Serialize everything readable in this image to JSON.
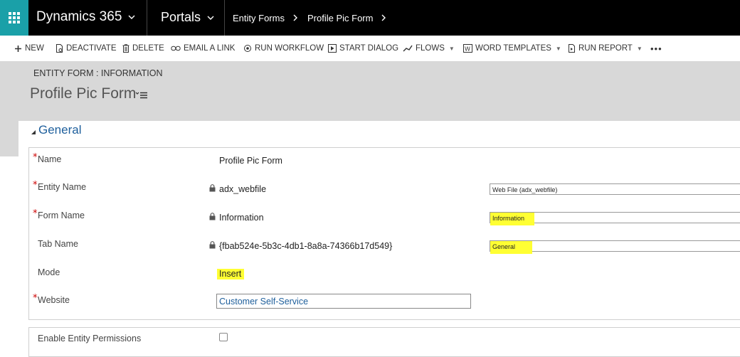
{
  "nav": {
    "app_name": "Dynamics 365",
    "area": "Portals",
    "breadcrumb": [
      "Entity Forms",
      "Profile Pic Form"
    ]
  },
  "commands": {
    "new": "NEW",
    "deactivate": "DEACTIVATE",
    "delete": "DELETE",
    "email_link": "EMAIL A LINK",
    "run_workflow": "RUN WORKFLOW",
    "start_dialog": "START DIALOG",
    "flows": "FLOWS",
    "word_templates": "WORD TEMPLATES",
    "run_report": "RUN REPORT",
    "more": "•••"
  },
  "header": {
    "entity_label": "ENTITY FORM : INFORMATION",
    "title": "Profile Pic Form"
  },
  "section": {
    "title": "General"
  },
  "fields": {
    "name": {
      "label": "Name",
      "value": "Profile Pic Form"
    },
    "entity_name": {
      "label": "Entity Name",
      "value": "adx_webfile",
      "select": "Web File (adx_webfile)"
    },
    "form_name": {
      "label": "Form Name",
      "value": "Information",
      "select": "Information"
    },
    "tab_name": {
      "label": "Tab Name",
      "value": "{fbab524e-5b3c-4db1-8a8a-74366b17d549}",
      "select": "General"
    },
    "mode": {
      "label": "Mode",
      "value": "Insert"
    },
    "website": {
      "label": "Website",
      "value": "Customer Self-Service"
    },
    "enable_permissions": {
      "label": "Enable Entity Permissions"
    }
  },
  "required_mark": "*",
  "colors": {
    "accent": "#1e5f9c",
    "waffle": "#1aa0a8",
    "highlight": "#ffff33"
  }
}
